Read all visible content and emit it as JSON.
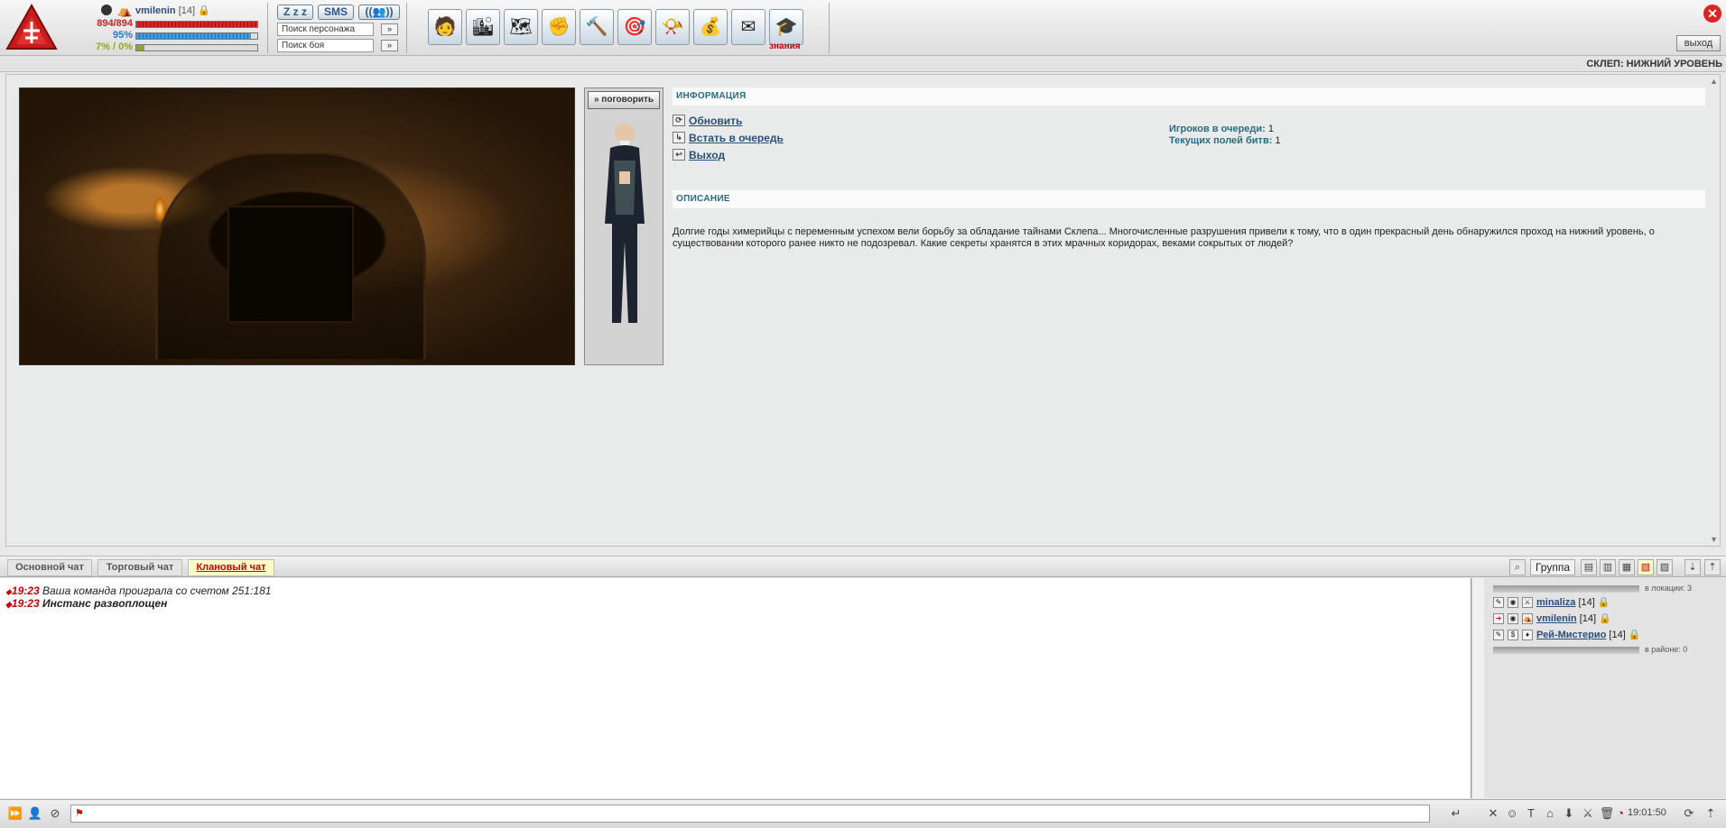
{
  "header": {
    "username": "vmilenin",
    "level": "[14]",
    "hp": "894/894",
    "mana": "95%",
    "exp": "7% / 0%",
    "btn_sleep": "Z z z",
    "btn_sms": "SMS",
    "btn_friends": "((👥))",
    "search_player": "Поиск персонажа",
    "search_fight": "Поиск боя",
    "go": "»",
    "knowledge": "знания",
    "exit": "выход",
    "hp_fill": 1.0,
    "mana_fill": 0.95,
    "exp_fill": 0.07
  },
  "location": "СКЛЕП: НИЖНИЙ УРОВЕНЬ",
  "npc": {
    "talk": "» поговорить"
  },
  "info": {
    "header": "ИНФОРМАЦИЯ",
    "actions": [
      "Обновить",
      "Встать в очередь",
      "Выход"
    ],
    "queue_label": "Игроков в очереди:",
    "queue_value": "1",
    "fields_label": "Текущих полей битв:",
    "fields_value": "1"
  },
  "description": {
    "header": "ОПИСАНИЕ",
    "text": "Долгие годы химерийцы с переменным успехом вели борьбу за обладание тайнами Склепа... Многочисленные разрушения привели к тому, что в один прекрасный день обнаружился проход на нижний уровень, о существовании которого ранее никто не подозревал. Какие секреты хранятся в этих мрачных коридорах, веками сокрытых от людей?"
  },
  "tabs": [
    "Основной чат",
    "Торговый чат",
    "Клановый чат"
  ],
  "group_btn": "Группа",
  "chat": [
    {
      "time": "19:23",
      "text": "Ваша команда проиграла со счетом 251:181",
      "bold": false
    },
    {
      "time": "19:23",
      "text": "Инстанс развоплощен",
      "bold": true
    }
  ],
  "players": {
    "in_location": "в локации: 3",
    "in_region": "в районе: 0",
    "list": [
      {
        "name": "minaliza",
        "level": "[14]"
      },
      {
        "name": "vmilenin",
        "level": "[14]"
      },
      {
        "name": "Рей-Мистерио",
        "level": "[14]"
      }
    ]
  },
  "clock": "19:01:50",
  "colors": {
    "accent": "#2b6b80",
    "alert": "#cc0000",
    "hp": "#cc2222",
    "mana": "#2a8fd6",
    "exp": "#8aaa22"
  }
}
